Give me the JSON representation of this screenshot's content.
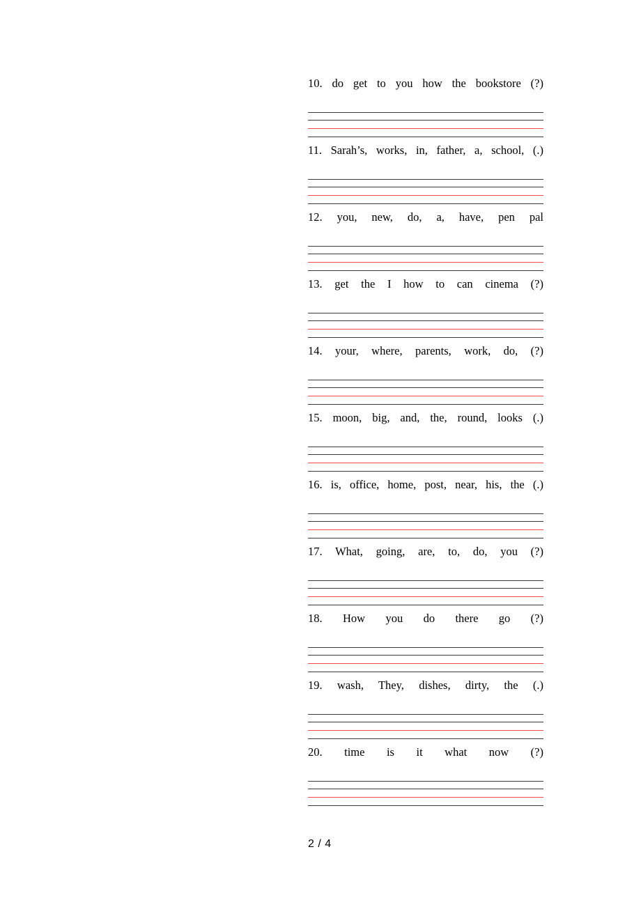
{
  "document": {
    "type": "worksheet",
    "title": "Unscramble the sentences worksheet",
    "page_label": "2 / 4"
  },
  "colors": {
    "rule_dark": "#3a3a3a",
    "rule_red": "#f94a4a",
    "text": "#000000",
    "background": "#ffffff"
  },
  "items": [
    {
      "number": "10.",
      "text": "do get to you how the bookstore (?)",
      "full": "10. do get to you how the bookstore (?)"
    },
    {
      "number": "11.",
      "text": "Sarah’s, works, in, father, a, school, (.)",
      "full": "11. Sarah’s, works, in, father, a, school, (.)"
    },
    {
      "number": "12.",
      "text": "you, new, do, a, have, pen pal",
      "full": "12. you, new, do, a, have, pen pal"
    },
    {
      "number": "13.",
      "text": "get the I how to can cinema (?)",
      "full": "13. get  the  I  how  to  can  cinema (?)"
    },
    {
      "number": "14.",
      "text": "your, where, parents, work, do, (?)",
      "full": "14. your, where, parents, work, do, (?)"
    },
    {
      "number": "15.",
      "text": "moon, big, and, the, round, looks (.)",
      "full": "15. moon, big, and, the, round, looks (.)"
    },
    {
      "number": "16.",
      "text": "is, office, home, post, near, his, the (.)",
      "full": "16. is, office, home, post, near, his, the (.)"
    },
    {
      "number": "17.",
      "text": "What, going, are, to, do, you (?)",
      "full": "17. What, going, are, to, do, you (?)"
    },
    {
      "number": "18.",
      "text": "How you do there go (?)",
      "full": "18. How  you  do  there  go (?)"
    },
    {
      "number": "19.",
      "text": "wash, They, dishes, dirty, the (.)",
      "full": "19. wash, They, dishes, dirty, the (.)"
    },
    {
      "number": "20.",
      "text": "time is it what now (?)",
      "full": "20. time    is    it    what    now  (?)"
    }
  ],
  "answer_lines": {
    "rows_per_item": 4,
    "pattern": [
      "dark",
      "dark",
      "red",
      "dark"
    ]
  }
}
